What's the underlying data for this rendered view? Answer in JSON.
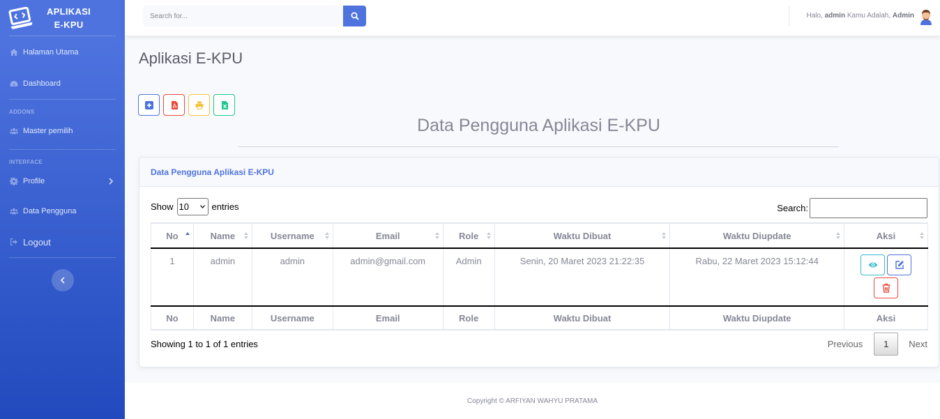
{
  "brand": {
    "line1": "APLIKASI",
    "line2": "E-KPU"
  },
  "sidebar": {
    "items": [
      {
        "label": "Halaman Utama",
        "icon": "home-icon"
      },
      {
        "label": "Dashboard",
        "icon": "tachometer-icon"
      }
    ],
    "addons_heading": "ADDONS",
    "addons": [
      {
        "label": "Master pemilih",
        "icon": "users-icon"
      }
    ],
    "interface_heading": "INTERFACE",
    "interface": [
      {
        "label": "Profile",
        "icon": "gear-icon"
      },
      {
        "label": "Data Pengguna",
        "icon": "users-icon"
      },
      {
        "label": "Logout",
        "icon": "sign-out-icon"
      }
    ]
  },
  "topbar": {
    "search_placeholder": "Search for...",
    "greeting_prefix": "Halo,",
    "username": "admin",
    "role_prefix": "Kamu Adalah,",
    "role": "Admin"
  },
  "page": {
    "heading": "Aplikasi E-KPU",
    "center_title": "Data Pengguna Aplikasi E-KPU",
    "actions": [
      {
        "name": "add",
        "color": "#4e73df"
      },
      {
        "name": "pdf",
        "color": "#e74a3b"
      },
      {
        "name": "print",
        "color": "#f6c23e"
      },
      {
        "name": "excel",
        "color": "#1cc88a"
      }
    ]
  },
  "card": {
    "title": "Data Pengguna Aplikasi E-KPU",
    "show_label": "Show",
    "entries_value": "10",
    "entries_label": "entries",
    "search_label": "Search:",
    "columns": [
      "No",
      "Name",
      "Username",
      "Email",
      "Role",
      "Waktu Dibuat",
      "Waktu Diupdate",
      "Aksi"
    ],
    "rows": [
      {
        "no": "1",
        "name": "admin",
        "username": "admin",
        "email": "admin@gmail.com",
        "role": "Admin",
        "created": "Senin, 20 Maret 2023 21:22:35",
        "updated": "Rabu, 22 Maret 2023 15:12:44"
      }
    ],
    "info": "Showing 1 to 1 of 1 entries",
    "pagination": {
      "previous": "Previous",
      "current": "1",
      "next": "Next"
    }
  },
  "footer": {
    "text": "Copyright © ARFIYAN WAHYU PRATAMA"
  }
}
